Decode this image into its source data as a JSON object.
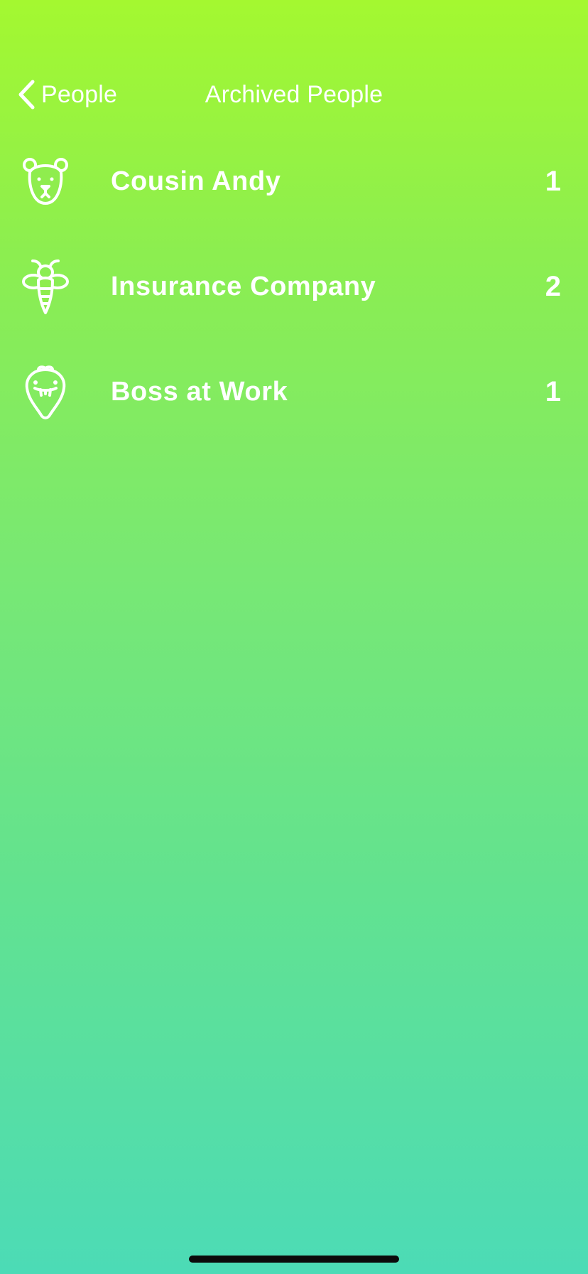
{
  "nav": {
    "back_label": "People",
    "title": "Archived People"
  },
  "people": [
    {
      "name": "Cousin Andy",
      "count": "1",
      "icon": "bear-icon"
    },
    {
      "name": "Insurance Company",
      "count": "2",
      "icon": "bee-icon"
    },
    {
      "name": "Boss at Work",
      "count": "1",
      "icon": "snake-icon"
    }
  ],
  "colors": {
    "gradient_top": "#a4f830",
    "gradient_bottom": "#4cdbb6",
    "text": "#ffffff"
  }
}
